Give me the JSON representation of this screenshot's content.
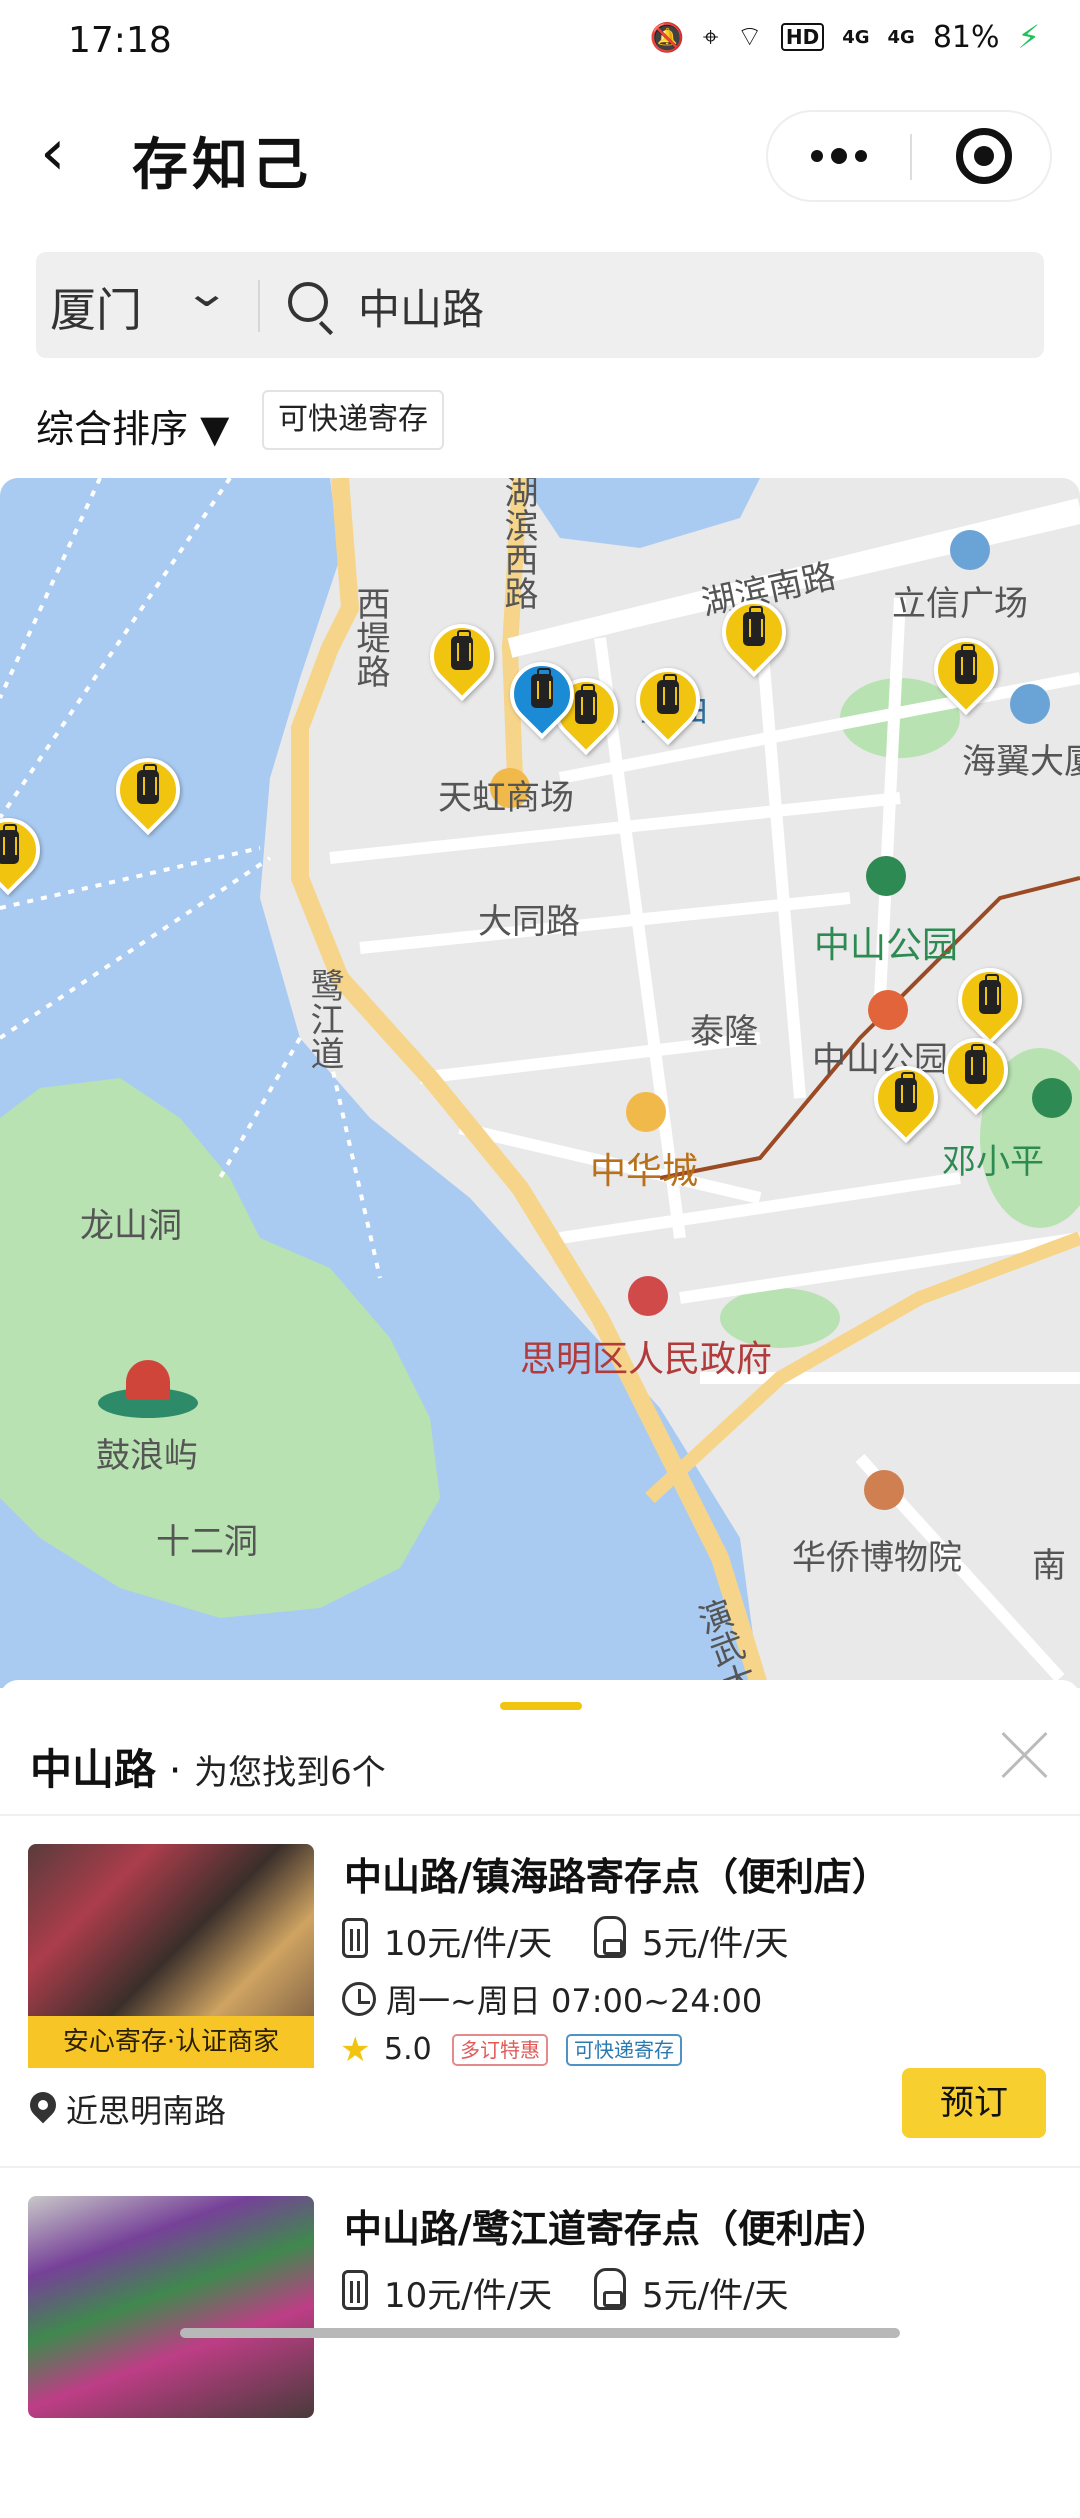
{
  "status_bar": {
    "time": "17:18",
    "icons": [
      "bell-off-icon",
      "location-icon",
      "wifi-icon",
      "hd-icon",
      "signal-4g-icon",
      "signal-4g-icon"
    ],
    "hd_label": "HD",
    "signal_label": "4G",
    "battery": "81%"
  },
  "header": {
    "back_symbol": "‹",
    "title": "存知己"
  },
  "search": {
    "city": "厦门",
    "query": "中山路"
  },
  "filters": {
    "sort_label": "综合排序 ▼",
    "tag_label": "可快递寄存"
  },
  "map": {
    "labels": {
      "hubin_west_road": "湖滨西路",
      "hubin_south_road": "湖滨南路",
      "lixin_plaza": "立信广场",
      "xidi_road": "西堤路",
      "moqu": "墨曲",
      "tianhong_mall": "天虹商场",
      "haiyi": "海翼大厦",
      "datong_road": "大同路",
      "zhongshan_park": "中山公园",
      "zhongshan_park_station": "中山公园",
      "lujiang_road": "鹭江道",
      "tailong": "泰隆",
      "zhonghua_city": "中华城",
      "deng_xiaoping": "邓小平",
      "longshan_cave": "龙山洞",
      "siming_gov": "思明区人民政府",
      "gulangyu": "鼓浪屿",
      "shier_cave": "十二洞",
      "huaqiao_museum": "华侨博物院",
      "nan": "南",
      "yanwu_road": "演武大"
    },
    "colors": {
      "water": "#a9cbf2",
      "land": "#e9e9e9",
      "park": "#b8e2b2",
      "road_major": "#f6d58a",
      "road_minor": "#ffffff",
      "pin_yellow": "#f1c40f",
      "pin_blue": "#1b8bd6"
    }
  },
  "results": {
    "keyword": "中山路",
    "dot": "·",
    "summary": "为您找到6个",
    "items": [
      {
        "title": "中山路/镇海路寄存点（便利店）",
        "badge": "安心寄存·认证商家",
        "suitcase_price": "10元/件/天",
        "backpack_price": "5元/件/天",
        "hours": "周一~周日 07:00~24:00",
        "rating": "5.0",
        "tags": [
          "多订特惠",
          "可快递寄存"
        ],
        "near": "近思明南路",
        "book_label": "预订"
      },
      {
        "title": "中山路/鹭江道寄存点（便利店）",
        "suitcase_price": "10元/件/天",
        "backpack_price": "5元/件/天"
      }
    ]
  }
}
